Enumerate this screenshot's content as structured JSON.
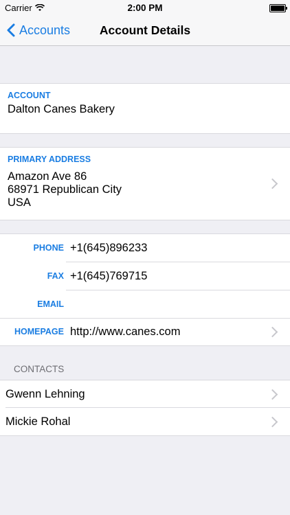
{
  "status": {
    "carrier": "Carrier",
    "time": "2:00 PM"
  },
  "nav": {
    "back_label": "Accounts",
    "title": "Account Details"
  },
  "account": {
    "label": "ACCOUNT",
    "name": "Dalton Canes Bakery"
  },
  "address": {
    "label": "PRIMARY ADDRESS",
    "line1": "Amazon Ave 86",
    "line2": "68971 Republican City",
    "line3": "USA"
  },
  "info": {
    "phone_label": "PHONE",
    "phone": "+1(645)896233",
    "fax_label": "FAX",
    "fax": "+1(645)769715",
    "email_label": "EMAIL",
    "email": "",
    "homepage_label": "HOMEPAGE",
    "homepage": "http://www.canes.com"
  },
  "contacts": {
    "header": "CONTACTS",
    "items": [
      "Gwenn Lehning",
      "Mickie Rohal"
    ]
  },
  "colors": {
    "accent": "#1a7de2",
    "background": "#efeff4"
  }
}
